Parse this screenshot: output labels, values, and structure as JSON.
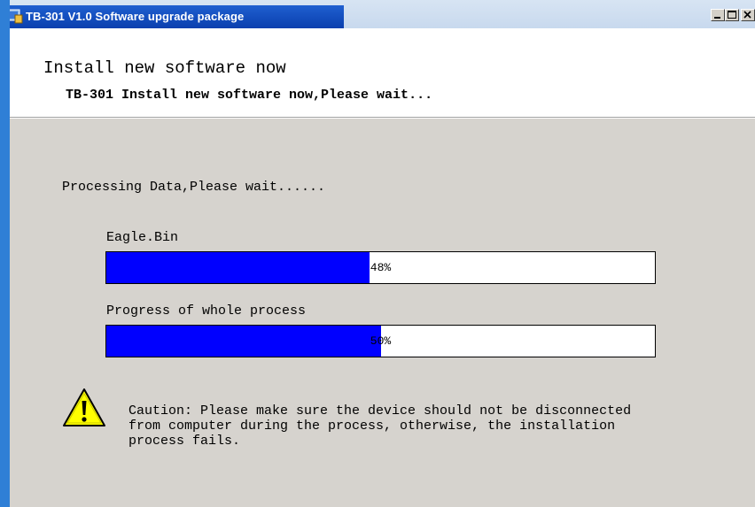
{
  "window": {
    "title": "TB-301  V1.0 Software upgrade package"
  },
  "header": {
    "title": "Install new software now",
    "subtitle": "TB-301 Install new software now,Please wait..."
  },
  "body": {
    "processing_text": "Processing Data,Please wait......",
    "file_progress": {
      "label": "Eagle.Bin",
      "value": 0.48,
      "text": "48%"
    },
    "whole_progress": {
      "label": "Progress of whole process",
      "value": 0.5,
      "text": "50%"
    },
    "caution": {
      "icon": "warning-icon",
      "lines": [
        "Caution: Please make sure the device should not be disconnected",
        "from computer during the process, otherwise, the installation",
        "process fails."
      ]
    }
  },
  "colors": {
    "title_bar": "#0a3fae",
    "progress_fill": "#0000ff",
    "dialog_background": "#d6d3ce"
  }
}
